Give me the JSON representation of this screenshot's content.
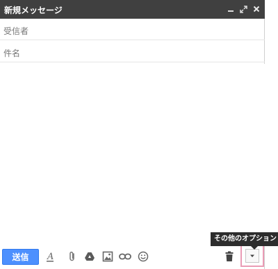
{
  "window": {
    "title": "新規メッセージ"
  },
  "fields": {
    "to_label": "受信者",
    "subject_label": "件名"
  },
  "toolbar": {
    "send_label": "送信",
    "icons": [
      "format-text-icon",
      "paperclip-icon",
      "drive-icon",
      "image-icon",
      "link-icon",
      "emoji-icon",
      "trash-icon",
      "dropdown-arrow-icon"
    ]
  },
  "tooltip": {
    "text": "その他のオプション"
  },
  "colors": {
    "titlebar": "#404040",
    "send_button": "#4d90fe",
    "highlight": "#ea9bb5"
  }
}
